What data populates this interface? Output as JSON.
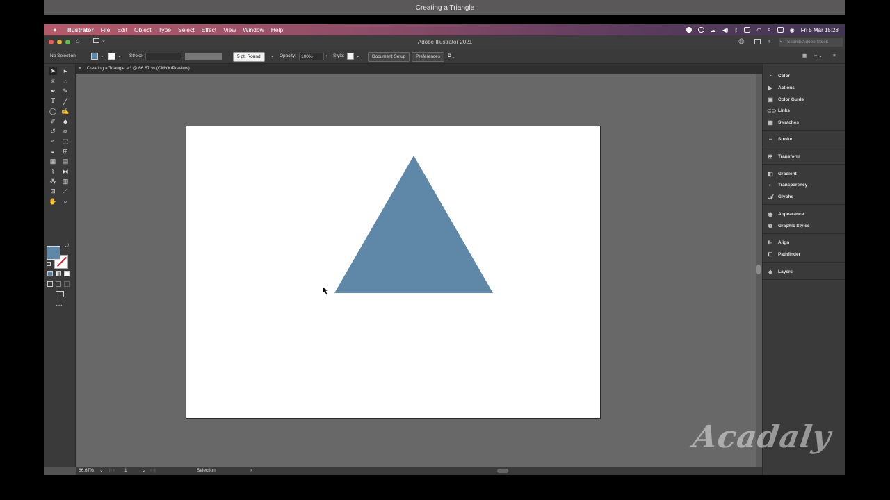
{
  "video": {
    "title": "Creating a Triangle"
  },
  "menubar": {
    "apple_icon": "apple-logo-icon",
    "app_name": "Illustrator",
    "items": [
      "File",
      "Edit",
      "Object",
      "Type",
      "Select",
      "Effect",
      "View",
      "Window",
      "Help"
    ],
    "clock": "Fri 5 Mar  15:28"
  },
  "appbar": {
    "title": "Adobe Illustrator 2021",
    "search_placeholder": "Search Adobe Stock"
  },
  "control": {
    "selection": "No Selection",
    "stroke_label": "Stroke:",
    "brush": "5 pt. Round",
    "opacity_label": "Opacity:",
    "opacity_value": "100%",
    "style_label": "Style:",
    "doc_setup": "Document Setup",
    "preferences": "Preferences"
  },
  "tab": {
    "close": "×",
    "title": "Creating a Triangle.ai* @ 66.67 % (CMYK/Preview)"
  },
  "status": {
    "zoom": "66.67%",
    "artboard_number": "1",
    "tool": "Selection"
  },
  "panels": [
    {
      "label": "Color",
      "icon": "color-panel-icon"
    },
    {
      "label": "Actions",
      "icon": "actions-play-icon"
    },
    {
      "label": "Color Guide",
      "icon": "color-guide-icon"
    },
    {
      "label": "Links",
      "icon": "links-chain-icon"
    },
    {
      "label": "Swatches",
      "icon": "swatches-grid-icon"
    },
    {
      "label": "Stroke",
      "icon": "stroke-lines-icon"
    },
    {
      "label": "Transform",
      "icon": "transform-icon"
    },
    {
      "label": "Gradient",
      "icon": "gradient-icon"
    },
    {
      "label": "Transparency",
      "icon": "transparency-icon"
    },
    {
      "label": "Glyphs",
      "icon": "glyphs-icon"
    },
    {
      "label": "Appearance",
      "icon": "appearance-icon"
    },
    {
      "label": "Graphic Styles",
      "icon": "graphic-styles-icon"
    },
    {
      "label": "Align",
      "icon": "align-icon"
    },
    {
      "label": "Pathfinder",
      "icon": "pathfinder-icon"
    },
    {
      "label": "Layers",
      "icon": "layers-icon"
    }
  ],
  "colors": {
    "fill": "#5f87a8",
    "triangle": "#5f87a8"
  },
  "watermark": "Acadaly"
}
